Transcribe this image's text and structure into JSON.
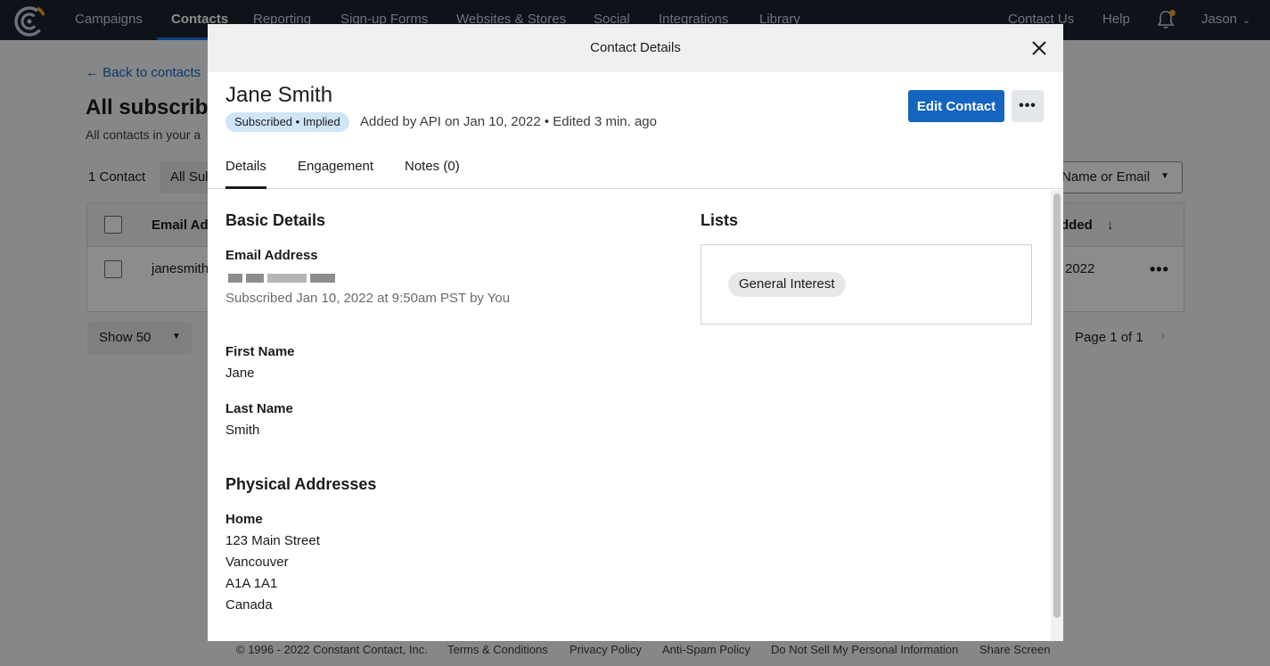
{
  "nav": {
    "items": [
      "Campaigns",
      "Contacts",
      "Reporting",
      "Sign-up Forms",
      "Websites & Stores",
      "Social",
      "Integrations",
      "Library"
    ],
    "active": "Contacts",
    "right_items": [
      "Contact Us",
      "Help"
    ],
    "user": "Jason"
  },
  "background": {
    "back_link": "← Back to contacts",
    "title": "All subscribe",
    "subtitle": "All contacts in your a",
    "count": "1 Contact",
    "filter": "All Sul",
    "search_placeholder": "Name or Email",
    "table": {
      "header_email": "Email Add",
      "header_added": "dded",
      "row_email": "janesmith",
      "row_date": "2022"
    },
    "show": "Show 50",
    "pagination": "Page 1 of 1",
    "footer": [
      "© 1996 - 2022 Constant Contact, Inc.",
      "Terms & Conditions",
      "Privacy Policy",
      "Anti-Spam Policy",
      "Do Not Sell My Personal Information",
      "Share Screen"
    ]
  },
  "modal": {
    "title": "Contact Details",
    "contact_name": "Jane Smith",
    "status_badge": "Subscribed • Implied",
    "added_info": "Added by API on Jan 10, 2022 • Edited 3 min. ago",
    "edit_button": "Edit Contact",
    "more_button": "•••",
    "tabs": [
      "Details",
      "Engagement",
      "Notes (0)"
    ],
    "active_tab": "Details",
    "basic_details": {
      "title": "Basic Details",
      "email_label": "Email Address",
      "email_subscribed": "Subscribed Jan 10, 2022 at 9:50am PST by You",
      "first_name_label": "First Name",
      "first_name": "Jane",
      "last_name_label": "Last Name",
      "last_name": "Smith"
    },
    "addresses": {
      "title": "Physical Addresses",
      "type": "Home",
      "street": "123 Main Street",
      "city": "Vancouver",
      "postal": "A1A 1A1",
      "country": "Canada"
    },
    "lists": {
      "title": "Lists",
      "items": [
        "General Interest"
      ]
    }
  },
  "colors": {
    "nav_bg": "#18232d",
    "primary": "#1565c0",
    "badge_bg": "#cfe5f8",
    "accent": "#f5a623"
  }
}
